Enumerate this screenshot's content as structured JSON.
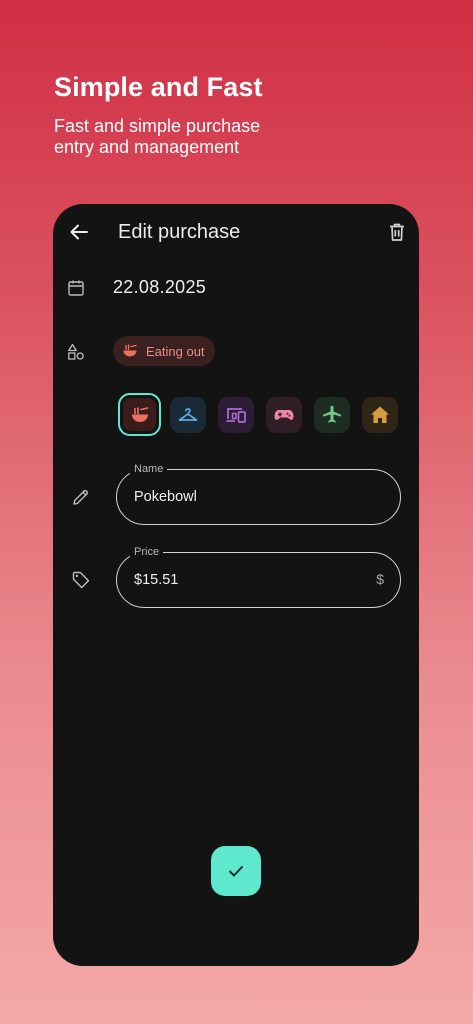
{
  "hero": {
    "title": "Simple and Fast",
    "subtitle": "Fast and simple purchase entry and management"
  },
  "appbar": {
    "title": "Edit purchase",
    "back_icon": "arrow-left-icon",
    "delete_icon": "trash-icon"
  },
  "purchase": {
    "date": "22.08.2025",
    "category_label": "Eating out",
    "name": {
      "label": "Name",
      "value": "Pokebowl"
    },
    "price": {
      "label": "Price",
      "value": "$15.51",
      "suffix": "$"
    }
  },
  "categories": [
    {
      "icon": "ramen-bowl-icon",
      "color": "#e8715f",
      "background": "#3a1c1c",
      "selected": true
    },
    {
      "icon": "clothes-hanger-icon",
      "color": "#5aa8e0",
      "background": "#1b2a37",
      "selected": false
    },
    {
      "icon": "devices-icon",
      "color": "#b06ad8",
      "background": "#2a1d34",
      "selected": false
    },
    {
      "icon": "gamepad-icon",
      "color": "#ef86a6",
      "background": "#2f1e25",
      "selected": false
    },
    {
      "icon": "airplane-icon",
      "color": "#73c98a",
      "background": "#1e2d22",
      "selected": false
    },
    {
      "icon": "house-icon",
      "color": "#d69d3e",
      "background": "#2f2617",
      "selected": false
    }
  ],
  "colors": {
    "accent": "#5ee9cf",
    "surface": "#131313",
    "category_chip_bg": "#3b2020",
    "category_chip_text": "#e98e86"
  }
}
